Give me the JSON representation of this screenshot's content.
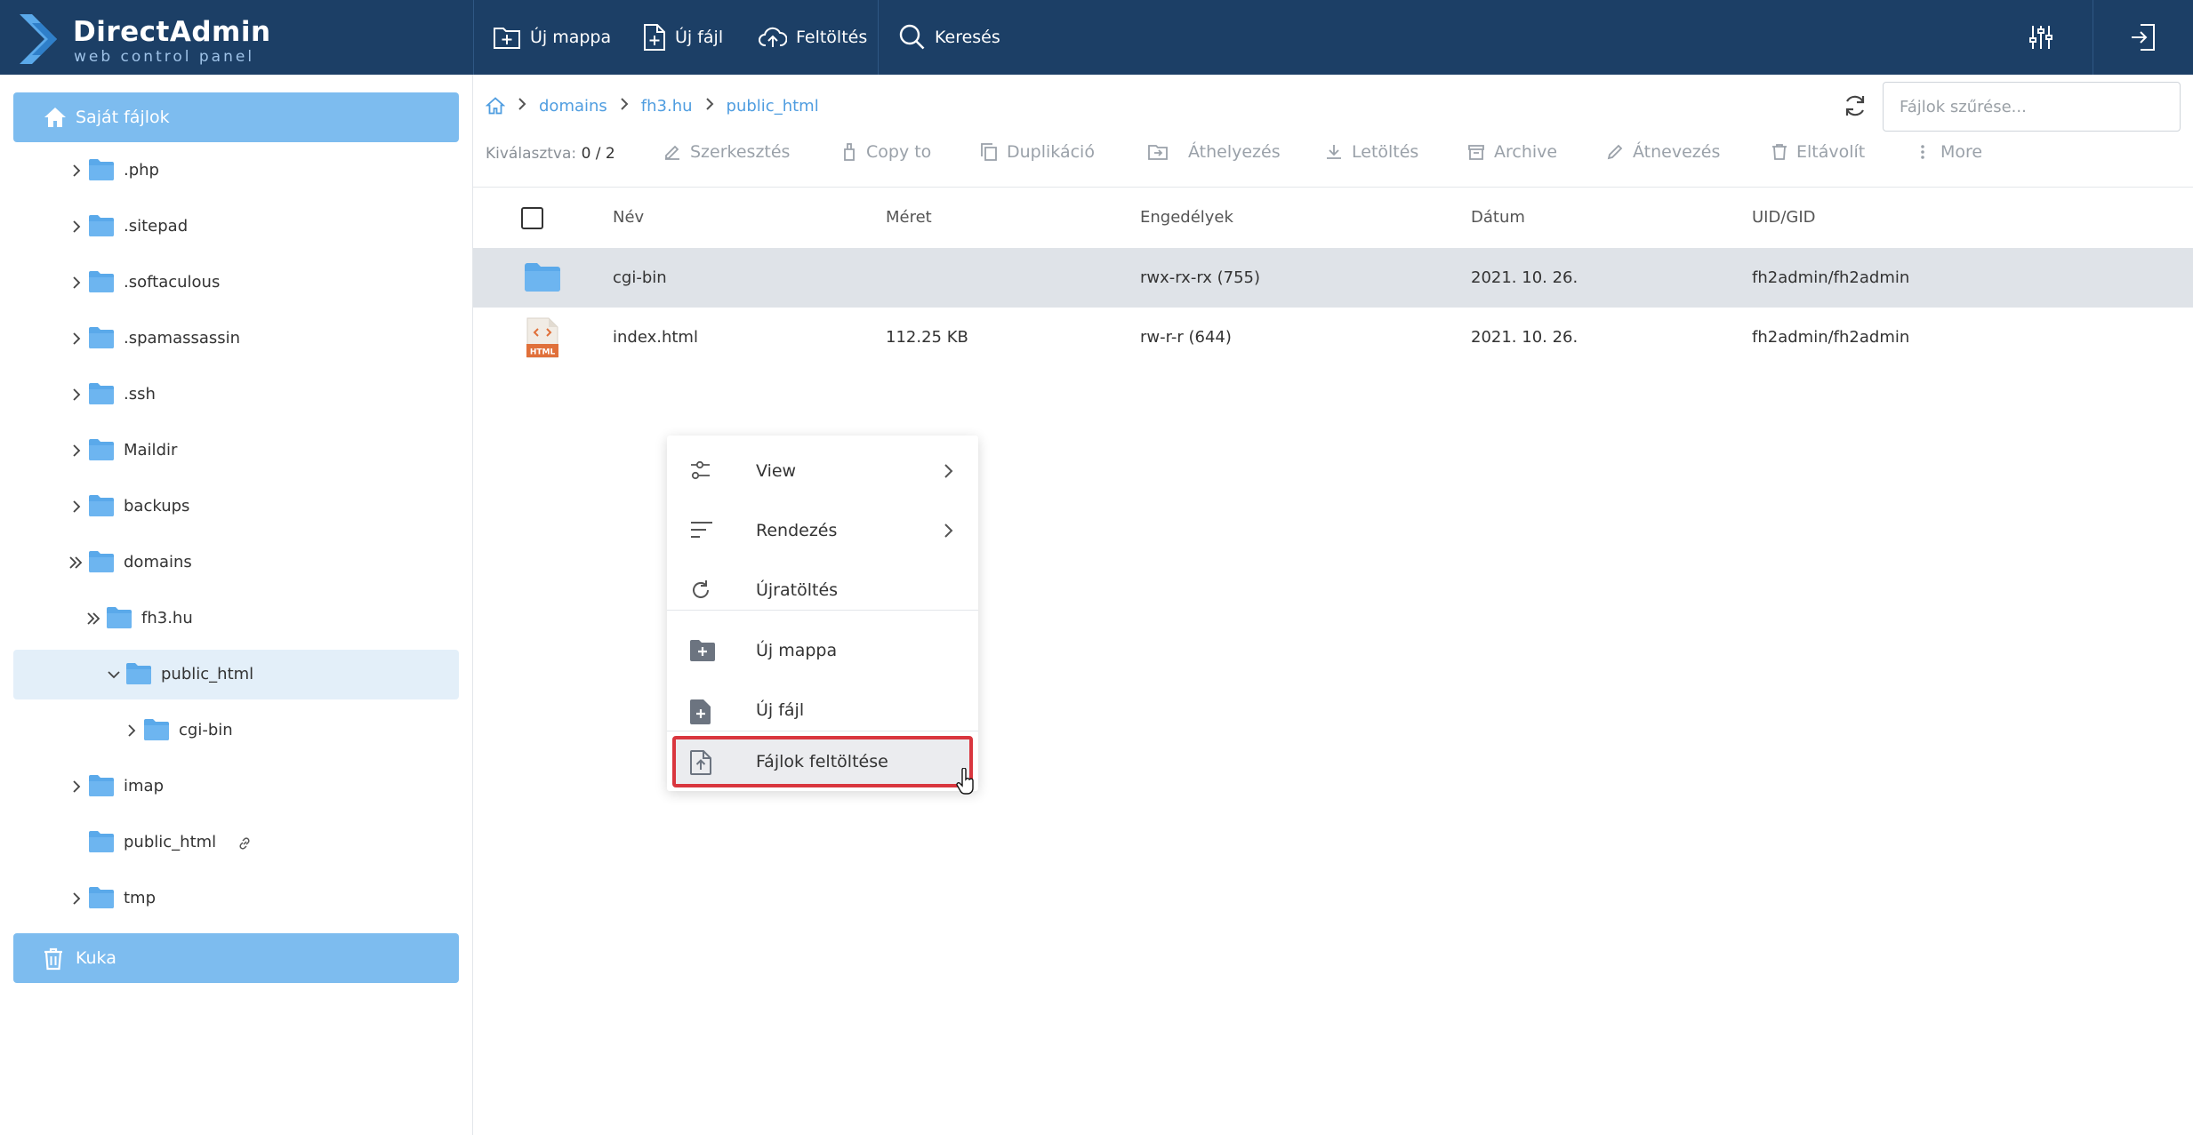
{
  "app": {
    "logo_name": "DirectAdmin",
    "logo_sub": "web control panel"
  },
  "topbar": {
    "new_folder": "Új mappa",
    "new_file": "Új fájl",
    "upload": "Feltöltés",
    "search": "Keresés",
    "settings_icon": "sliders-icon",
    "logout_icon": "logout-icon"
  },
  "sidebar": {
    "home_label": "Saját fájlok",
    "trash_label": "Kuka",
    "items": [
      {
        "label": ".php",
        "chevron": "right"
      },
      {
        "label": ".sitepad",
        "chevron": "right"
      },
      {
        "label": ".softaculous",
        "chevron": "right"
      },
      {
        "label": ".spamassassin",
        "chevron": "right"
      },
      {
        "label": ".ssh",
        "chevron": "right"
      },
      {
        "label": "Maildir",
        "chevron": "right"
      },
      {
        "label": "backups",
        "chevron": "right"
      },
      {
        "label": "domains",
        "chevron": "double"
      },
      {
        "label": "fh3.hu",
        "chevron": "double"
      },
      {
        "label": "public_html",
        "chevron": "down"
      },
      {
        "label": "cgi-bin",
        "chevron": "right"
      },
      {
        "label": "imap",
        "chevron": "right"
      },
      {
        "label": "public_html",
        "chevron": "none",
        "link": true
      },
      {
        "label": "tmp",
        "chevron": "right"
      }
    ]
  },
  "breadcrumb": {
    "items": [
      "domains",
      "fh3.hu",
      "public_html"
    ]
  },
  "filter": {
    "placeholder": "Fájlok szűrése..."
  },
  "actions": {
    "selected_label": "Kiválasztva:",
    "selected_value": "0 / 2",
    "edit": "Szerkesztés",
    "copy_to": "Copy to",
    "duplicate": "Duplikáció",
    "move": "Áthelyezés",
    "download": "Letöltés",
    "archive": "Archive",
    "rename": "Átnevezés",
    "remove": "Eltávolít",
    "more": "More"
  },
  "table": {
    "columns": [
      "Név",
      "Méret",
      "Engedélyek",
      "Dátum",
      "UID/GID"
    ],
    "rows": [
      {
        "name": "cgi-bin",
        "size": "",
        "perm": "rwx-rx-rx (755)",
        "date": "2021. 10. 26.",
        "uid": "fh2admin/fh2admin",
        "type": "folder"
      },
      {
        "name": "index.html",
        "size": "112.25 KB",
        "perm": "rw-r-r (644)",
        "date": "2021. 10. 26.",
        "uid": "fh2admin/fh2admin",
        "type": "html"
      }
    ]
  },
  "context_menu": {
    "view": "View",
    "sort": "Rendezés",
    "reload": "Újratöltés",
    "new_folder": "Új mappa",
    "new_file": "Új fájl",
    "upload_files": "Fájlok feltöltése"
  },
  "file_badge": "HTML",
  "colors": {
    "topbar": "#1c3f66",
    "accent": "#7dbcef",
    "link": "#4f9de0",
    "highlight_border": "#d9363e"
  }
}
